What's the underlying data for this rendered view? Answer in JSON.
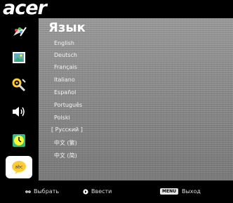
{
  "brand": {
    "logo_text": "acer"
  },
  "panel": {
    "title": "Язык",
    "languages": [
      "English",
      "Deutsch",
      "Français",
      "Italiano",
      "Español",
      "Português",
      "Polski",
      "[ Русский ]",
      "中文 (繁)",
      "中文 (简)"
    ],
    "selected_index": 7
  },
  "sidebar": {
    "items": [
      {
        "icon": "color-palette-icon"
      },
      {
        "icon": "picture-icon"
      },
      {
        "icon": "settings-tools-icon"
      },
      {
        "icon": "speaker-volume-icon"
      },
      {
        "icon": "timer-clock-icon"
      },
      {
        "icon": "language-speech-icon",
        "active": true
      }
    ]
  },
  "footer": {
    "select_label": "Выбрать",
    "enter_label": "Ввести",
    "menu_key": "MENU",
    "exit_label": "Выход"
  },
  "colors": {
    "background": "#000000",
    "panel": "#8f8f8f",
    "text": "#ffffff",
    "active_icon_bg": "#ffffff"
  }
}
